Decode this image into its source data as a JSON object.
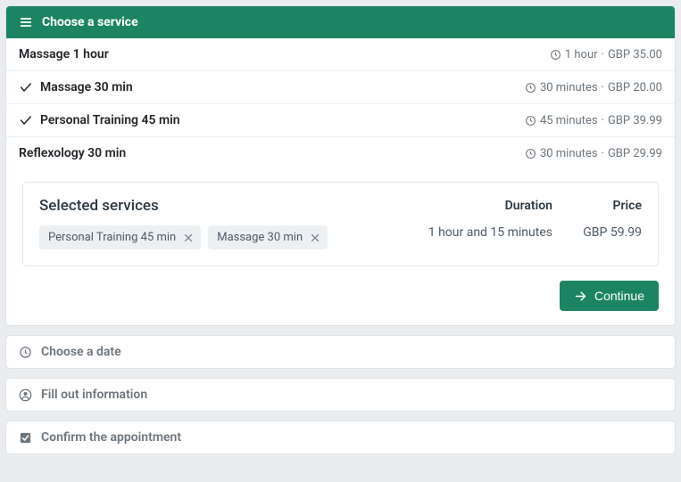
{
  "steps": {
    "choose_service": "Choose a service",
    "choose_date": "Choose a date",
    "fill_info": "Fill out information",
    "confirm": "Confirm the appointment"
  },
  "services": [
    {
      "name": "Massage 1 hour",
      "duration": "1 hour",
      "price": "GBP 35.00",
      "selected": false
    },
    {
      "name": "Massage 30 min",
      "duration": "30 minutes",
      "price": "GBP 20.00",
      "selected": true
    },
    {
      "name": "Personal Training 45 min",
      "duration": "45 minutes",
      "price": "GBP 39.99",
      "selected": true
    },
    {
      "name": "Reflexology 30 min",
      "duration": "30 minutes",
      "price": "GBP 29.99",
      "selected": false
    }
  ],
  "selected_panel": {
    "title": "Selected services",
    "chips": [
      "Personal Training 45 min",
      "Massage 30 min"
    ],
    "duration_label": "Duration",
    "duration_value": "1 hour and 15 minutes",
    "price_label": "Price",
    "price_value": "GBP 59.99"
  },
  "continue_label": "Continue"
}
